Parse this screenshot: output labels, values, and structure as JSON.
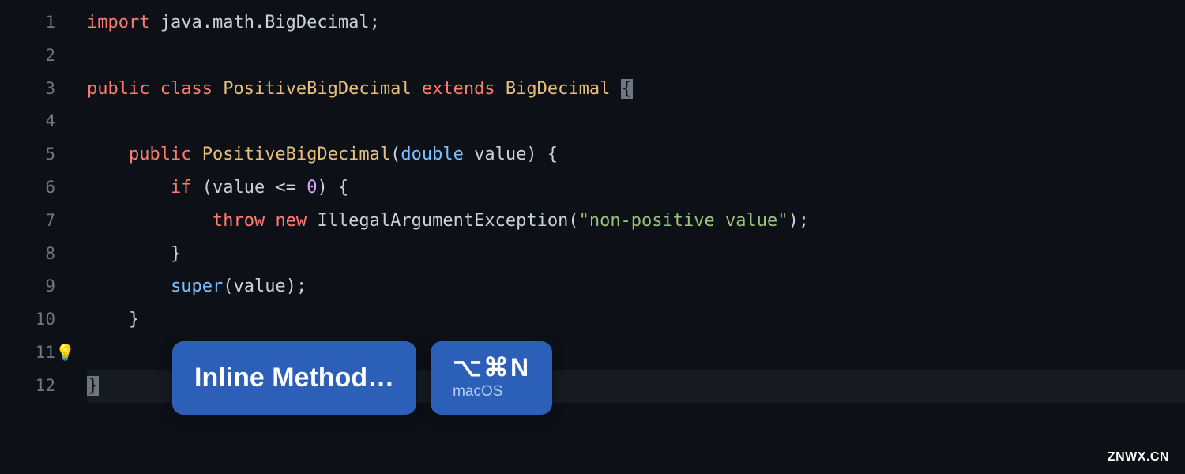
{
  "gutter": {
    "lines": [
      "1",
      "2",
      "3",
      "4",
      "5",
      "6",
      "7",
      "8",
      "9",
      "10",
      "11",
      "12"
    ]
  },
  "code": {
    "l1": {
      "import": "import",
      "pkg": "java.math.BigDecimal",
      "semi": ";"
    },
    "l3": {
      "public": "public",
      "class": "class",
      "name": "PositiveBigDecimal",
      "extends": "extends",
      "base": "BigDecimal",
      "brace": "{"
    },
    "l5": {
      "public": "public",
      "ctor": "PositiveBigDecimal",
      "lp": "(",
      "dtype": "double",
      "param": "value",
      "rp": ")",
      "brace": "{"
    },
    "l6": {
      "if": "if",
      "lp": "(",
      "cond_var": "value",
      "op": "<=",
      "zero": "0",
      "rp": ")",
      "brace": "{"
    },
    "l7": {
      "throw": "throw",
      "new": "new",
      "exc": "IllegalArgumentException",
      "lp": "(",
      "msg": "\"non-positive value\"",
      "rp": ")",
      "semi": ";"
    },
    "l8": {
      "rbrace": "}"
    },
    "l9": {
      "super": "super",
      "lp": "(",
      "arg": "value",
      "rp": ")",
      "semi": ";"
    },
    "l10": {
      "rbrace": "}"
    },
    "l12": {
      "rbrace": "}"
    }
  },
  "bulb": {
    "icon": "💡"
  },
  "tooltip": {
    "action": "Inline Method…",
    "shortcut_keys": "⌥⌘N",
    "os": "macOS"
  },
  "watermark": "ZNWX.CN"
}
